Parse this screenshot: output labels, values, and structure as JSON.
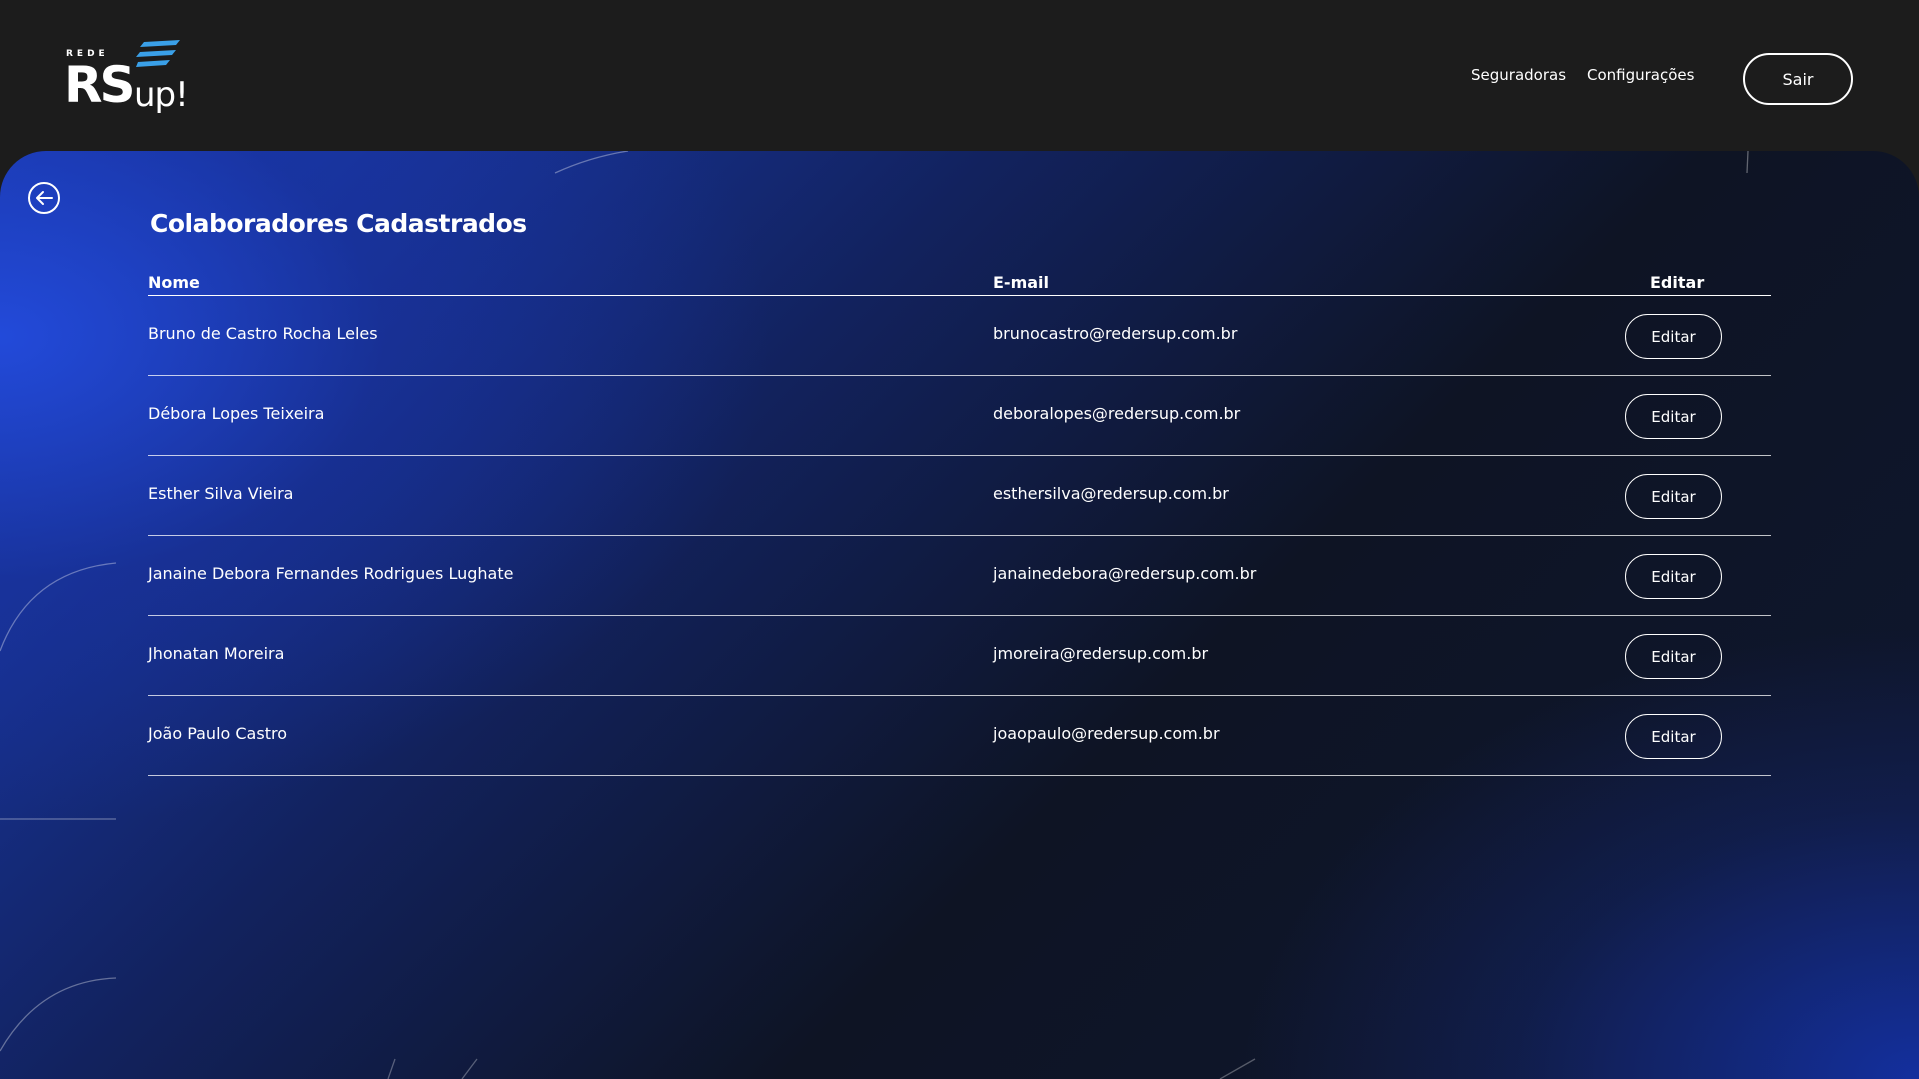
{
  "brand": {
    "top_text": "REDE",
    "main_text": "RS",
    "suffix_text": "up!",
    "accent_color": "#3aa0e8"
  },
  "nav": {
    "items": [
      {
        "label": "Seguradoras"
      },
      {
        "label": "Configurações"
      }
    ],
    "logout_label": "Sair"
  },
  "page": {
    "title": "Colaboradores Cadastrados",
    "back_icon": "arrow-left-circle-icon"
  },
  "table": {
    "headers": {
      "name": "Nome",
      "email": "E-mail",
      "edit": "Editar"
    },
    "rows": [
      {
        "name": "Bruno de Castro Rocha Leles",
        "email": "brunocastro@redersup.com.br",
        "action": "Editar"
      },
      {
        "name": "Débora Lopes Teixeira",
        "email": "deboralopes@redersup.com.br",
        "action": "Editar"
      },
      {
        "name": "Esther Silva Vieira",
        "email": "esthersilva@redersup.com.br",
        "action": "Editar"
      },
      {
        "name": "Janaine Debora Fernandes Rodrigues Lughate",
        "email": "janainedebora@redersup.com.br",
        "action": "Editar"
      },
      {
        "name": "Jhonatan Moreira",
        "email": "jmoreira@redersup.com.br",
        "action": "Editar"
      },
      {
        "name": "João Paulo Castro",
        "email": "joaopaulo@redersup.com.br",
        "action": "Editar"
      }
    ]
  }
}
